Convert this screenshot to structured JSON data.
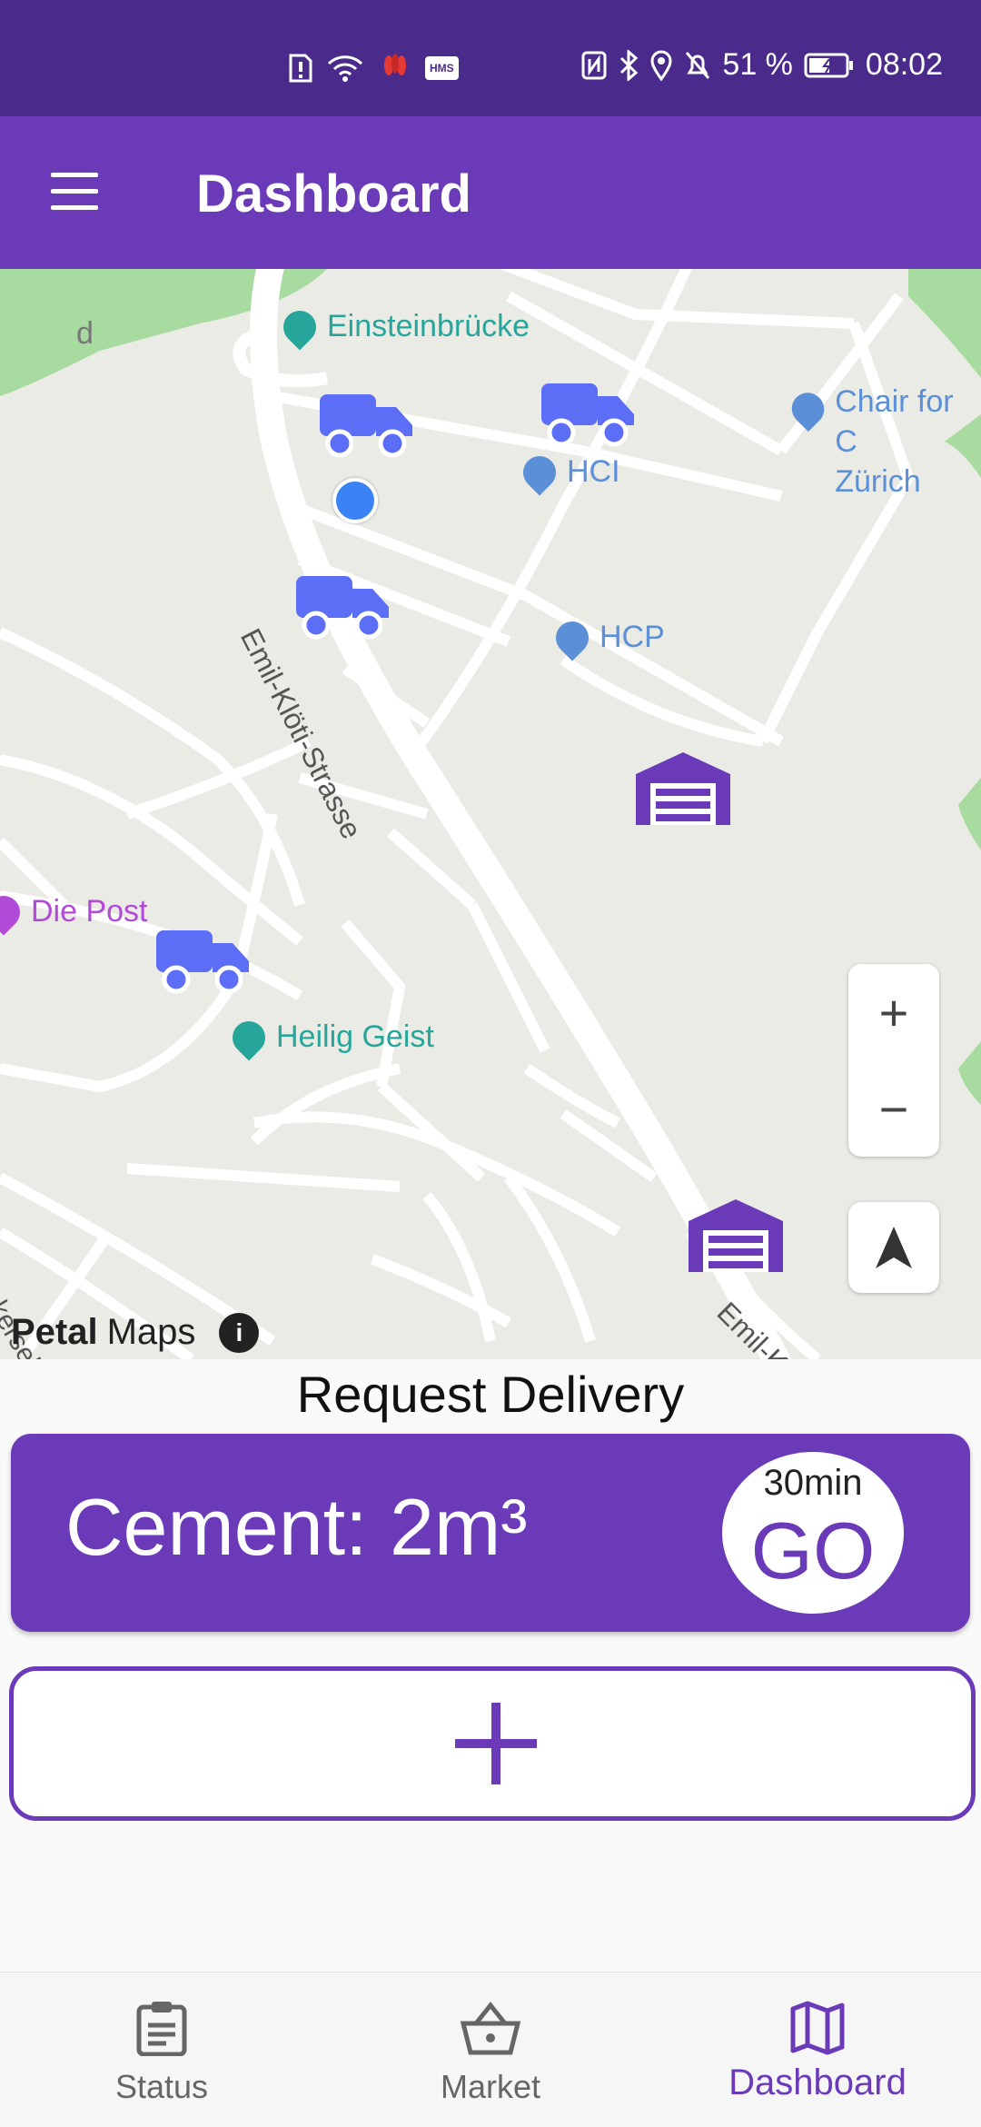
{
  "status_bar": {
    "battery": "51 %",
    "time": "08:02",
    "hms_label": "HMS",
    "icons_left": [
      "sim-alert-icon",
      "wifi-icon",
      "huawei-icon",
      "hms-icon"
    ],
    "icons_right": [
      "nfc-icon",
      "bluetooth-icon",
      "location-icon",
      "bell-off-icon",
      "battery-icon"
    ]
  },
  "app_bar": {
    "title": "Dashboard",
    "menu_icon": "hamburger-icon"
  },
  "map": {
    "pois": {
      "einsteinbrucke": "Einsteinbrücke",
      "chair": "Chair for C",
      "chair_line2": "Zürich",
      "hci": "HCI",
      "hcp": "HCP",
      "die_post": "Die Post",
      "heilig_geist": "Heilig Geist"
    },
    "street_labels": {
      "emil_kloti": "Emil-Klöti-Strasse",
      "emil_bottom": "Emil-K",
      "corner_d": "d",
      "bottom_left": "kerseli"
    },
    "zoom_in": "+",
    "zoom_out": "−",
    "attribution_brand": "Petal",
    "attribution_maps": "Maps",
    "attribution_info": "i",
    "colors": {
      "truck": "#5b6ef5",
      "depot": "#6a3ab8",
      "user_dot": "#3b82f6",
      "park": "#a8dba0",
      "road": "#ffffff",
      "land": "#ebebe6",
      "teal_poi": "#26a69a",
      "blue_poi": "#5b8fd8",
      "post_poi": "#b24ad8"
    }
  },
  "request": {
    "title": "Request Delivery",
    "item": "Cement: 2m³",
    "eta": "30min",
    "go": "GO",
    "add_label": "+"
  },
  "bottom_nav": {
    "items": [
      {
        "label": "Status",
        "icon": "clipboard-icon"
      },
      {
        "label": "Market",
        "icon": "basket-icon"
      },
      {
        "label": "Dashboard",
        "icon": "map-icon"
      }
    ],
    "active": "Dashboard",
    "accent": "#6a3ab8"
  }
}
